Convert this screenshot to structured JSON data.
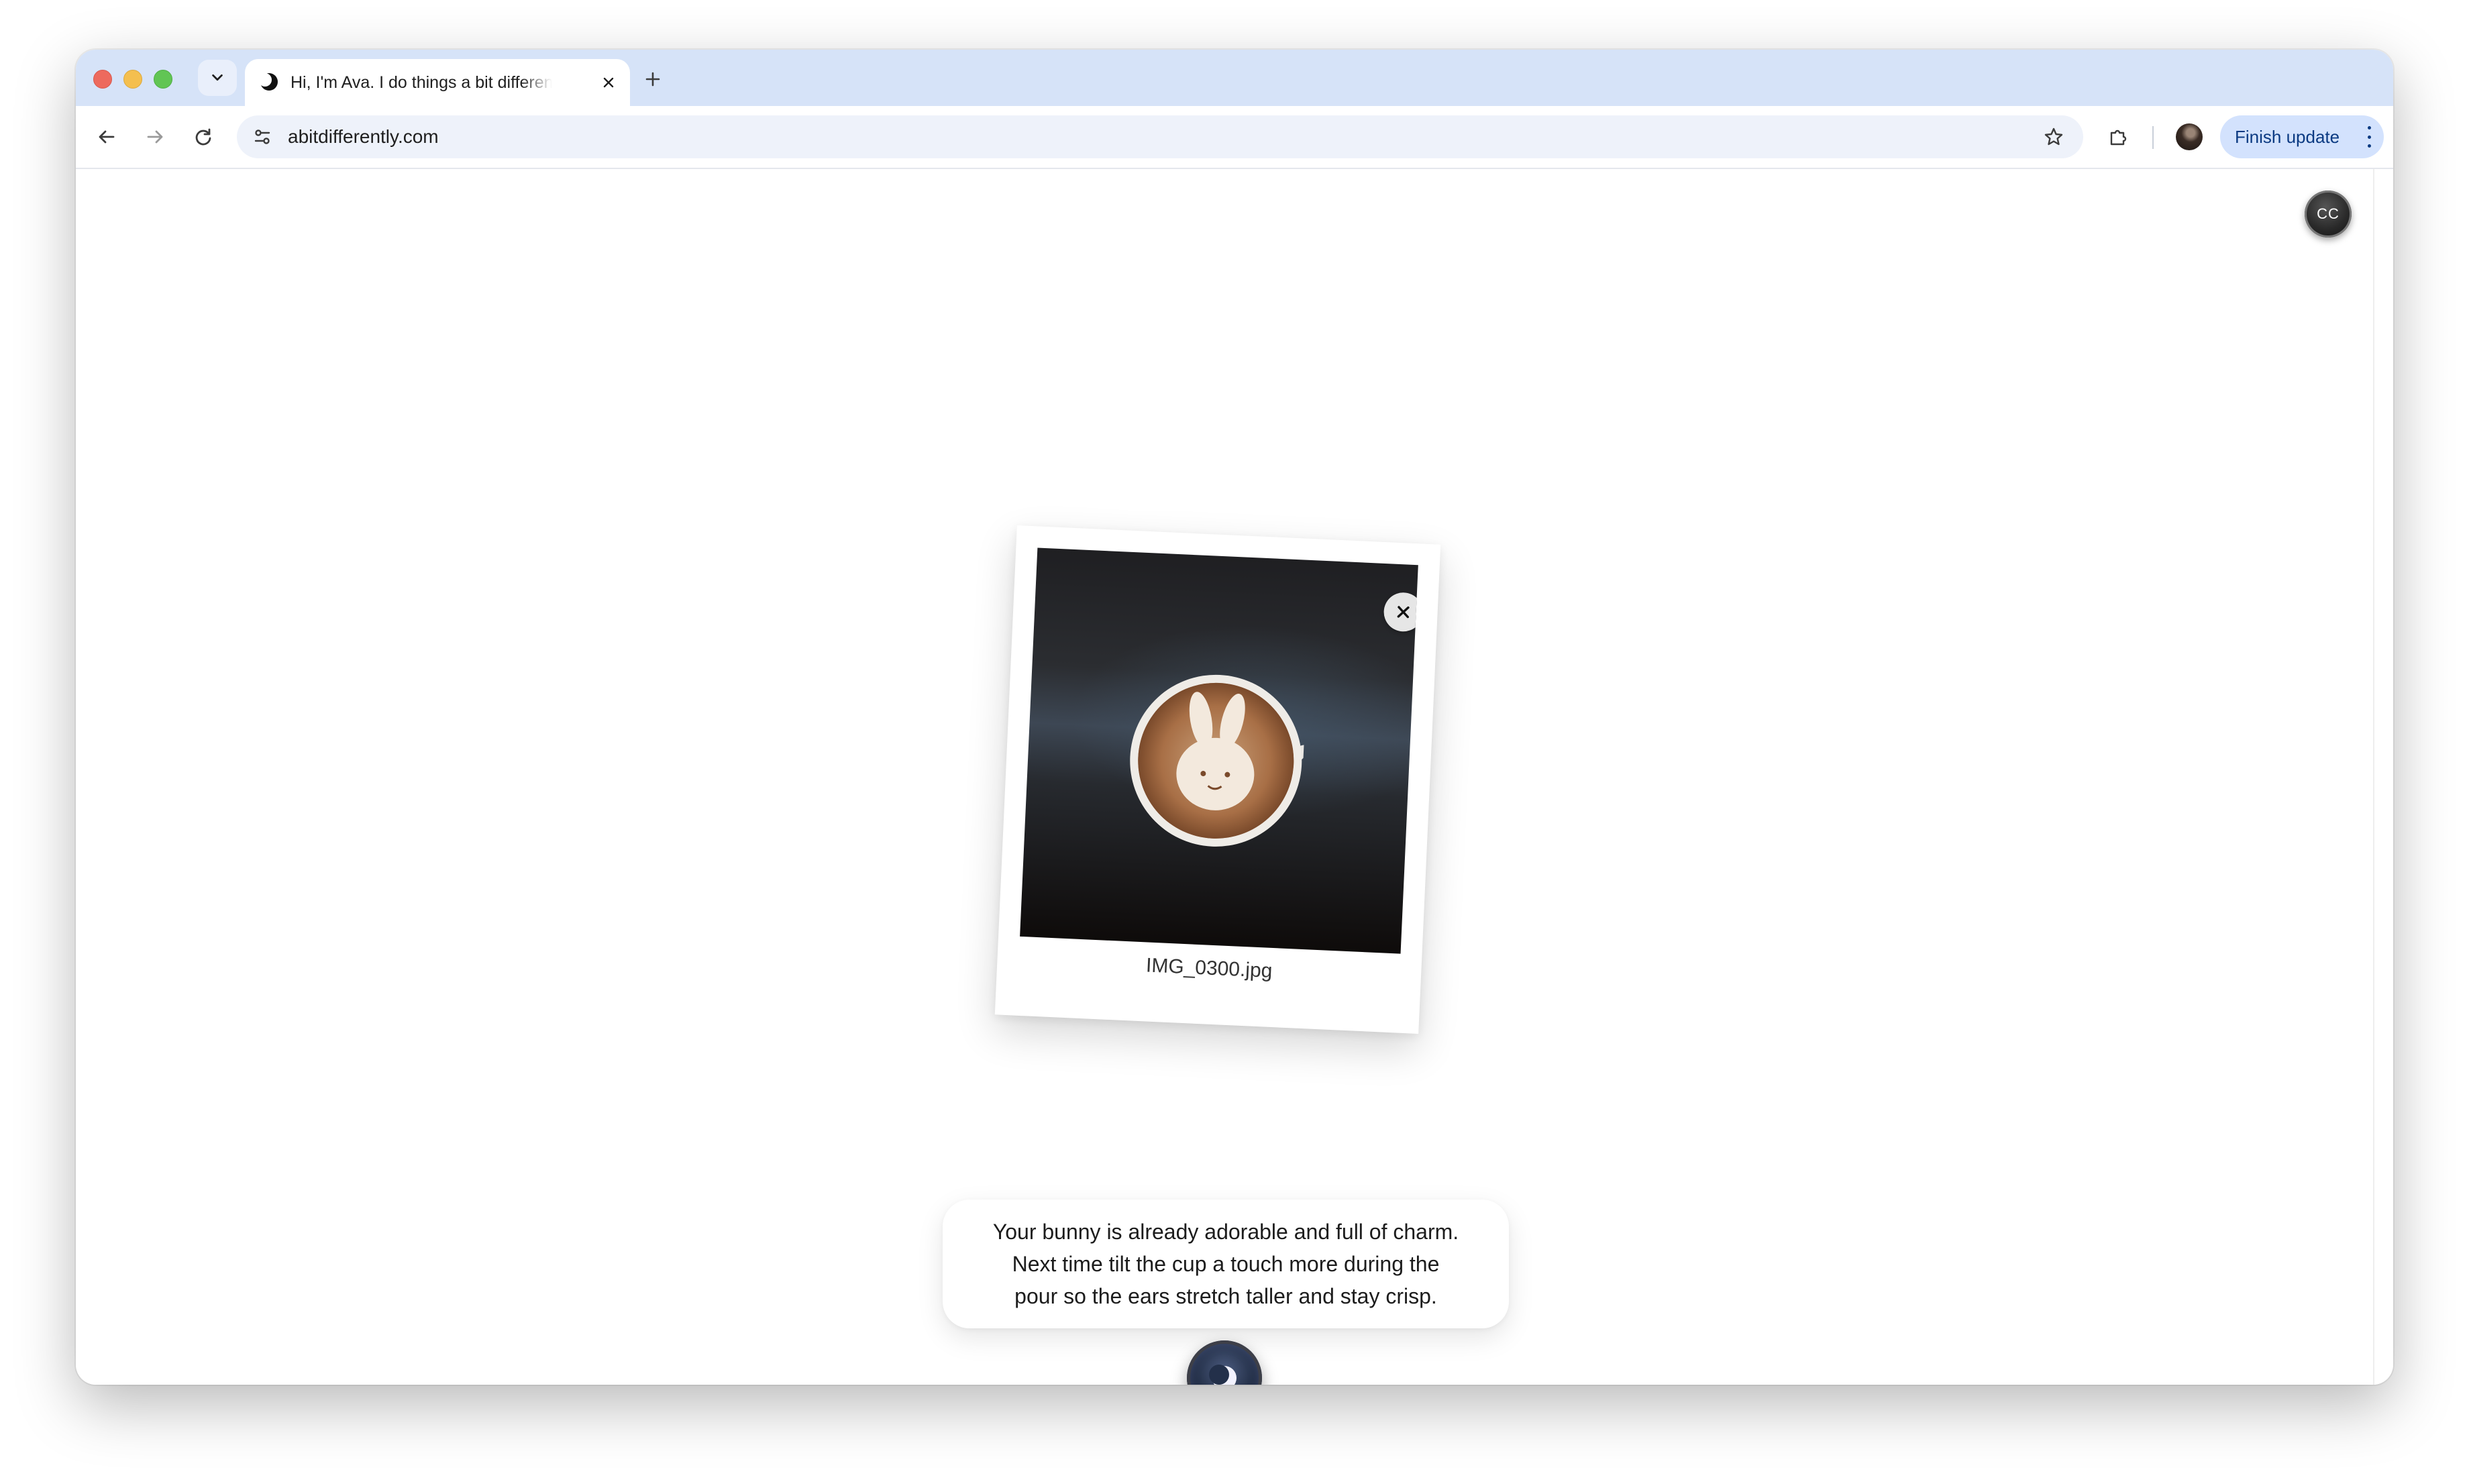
{
  "browser": {
    "tab": {
      "title": "Hi, I'm Ava. I do things a bit differently",
      "favicon": "moon-icon"
    },
    "toolbar": {
      "url": "abitdifferently.com",
      "finish_update_label": "Finish update"
    }
  },
  "page": {
    "cc_label": "CC",
    "photo": {
      "filename": "IMG_0300.jpg",
      "subject": "latte-art-bunny-photo"
    },
    "assistant": {
      "message": "Your bunny is already adorable and full of charm.\nNext time tilt the cup a touch more during the\npour so the ears stretch taller and stay crisp."
    }
  },
  "colors": {
    "tabstrip": "#d6e3f8",
    "omnibox": "#eef2fa",
    "finish_update_bg": "#d3e2fd",
    "finish_update_text": "#0b3a82"
  }
}
